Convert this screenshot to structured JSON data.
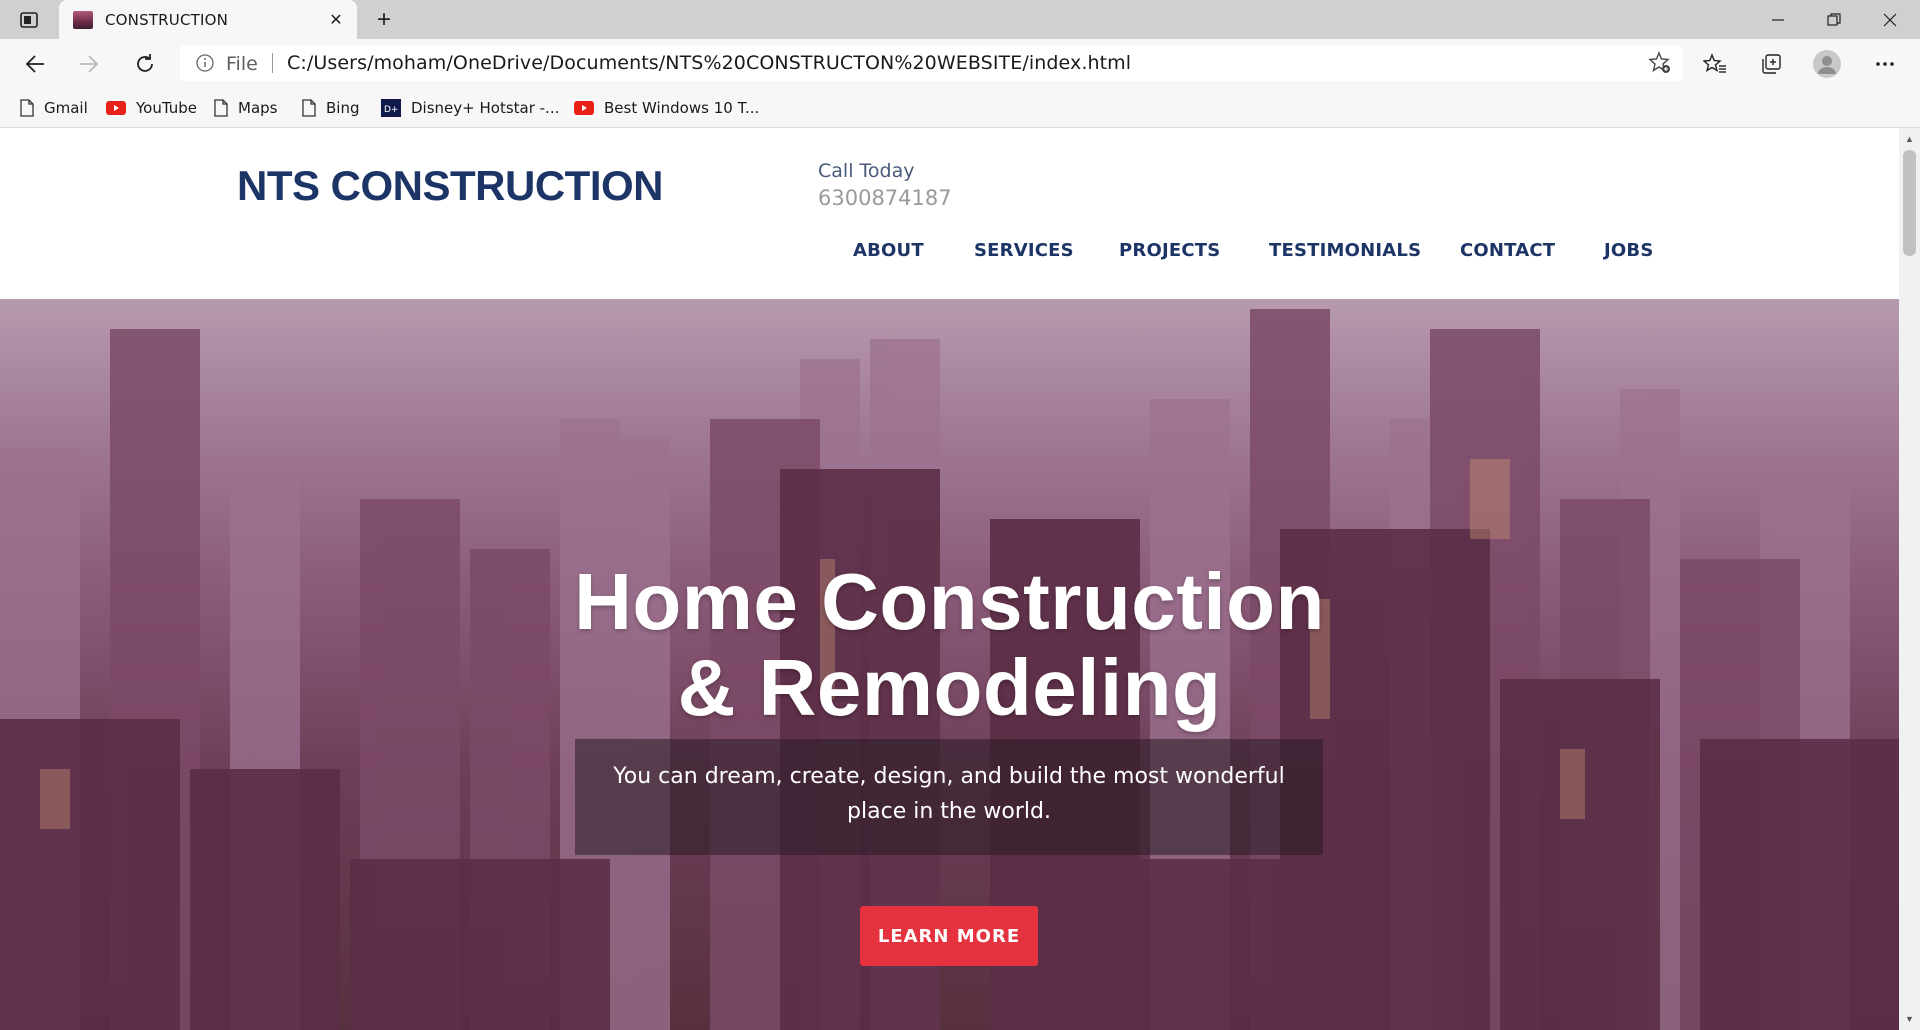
{
  "browser": {
    "tab_title": "CONSTRUCTION",
    "address_prefix": "File",
    "url": "C:/Users/moham/OneDrive/Documents/NTS%20CONSTRUCTON%20WEBSITE/index.html",
    "bookmarks": [
      {
        "label": "Gmail",
        "icon": "page-icon"
      },
      {
        "label": "YouTube",
        "icon": "youtube-icon"
      },
      {
        "label": "Maps",
        "icon": "page-icon"
      },
      {
        "label": "Bing",
        "icon": "page-icon"
      },
      {
        "label": "Disney+ Hotstar -...",
        "icon": "hotstar-icon"
      },
      {
        "label": "Best Windows 10 T...",
        "icon": "youtube-icon"
      }
    ]
  },
  "site": {
    "logo": "NTS CONSTRUCTION",
    "call_label": "Call Today",
    "phone": "6300874187",
    "nav": [
      "ABOUT",
      "SERVICES",
      "PROJECTS",
      "TESTIMONIALS",
      "CONTACT",
      "JOBS"
    ],
    "hero": {
      "title_line1": "Home Construction",
      "title_line2": "& Remodeling",
      "subtitle": "You can dream, create, design, and build the most wonderful place in the world.",
      "cta": "LEARN MORE"
    }
  },
  "colors": {
    "brand_navy": "#1d3566",
    "cta_red": "#e5323f"
  }
}
